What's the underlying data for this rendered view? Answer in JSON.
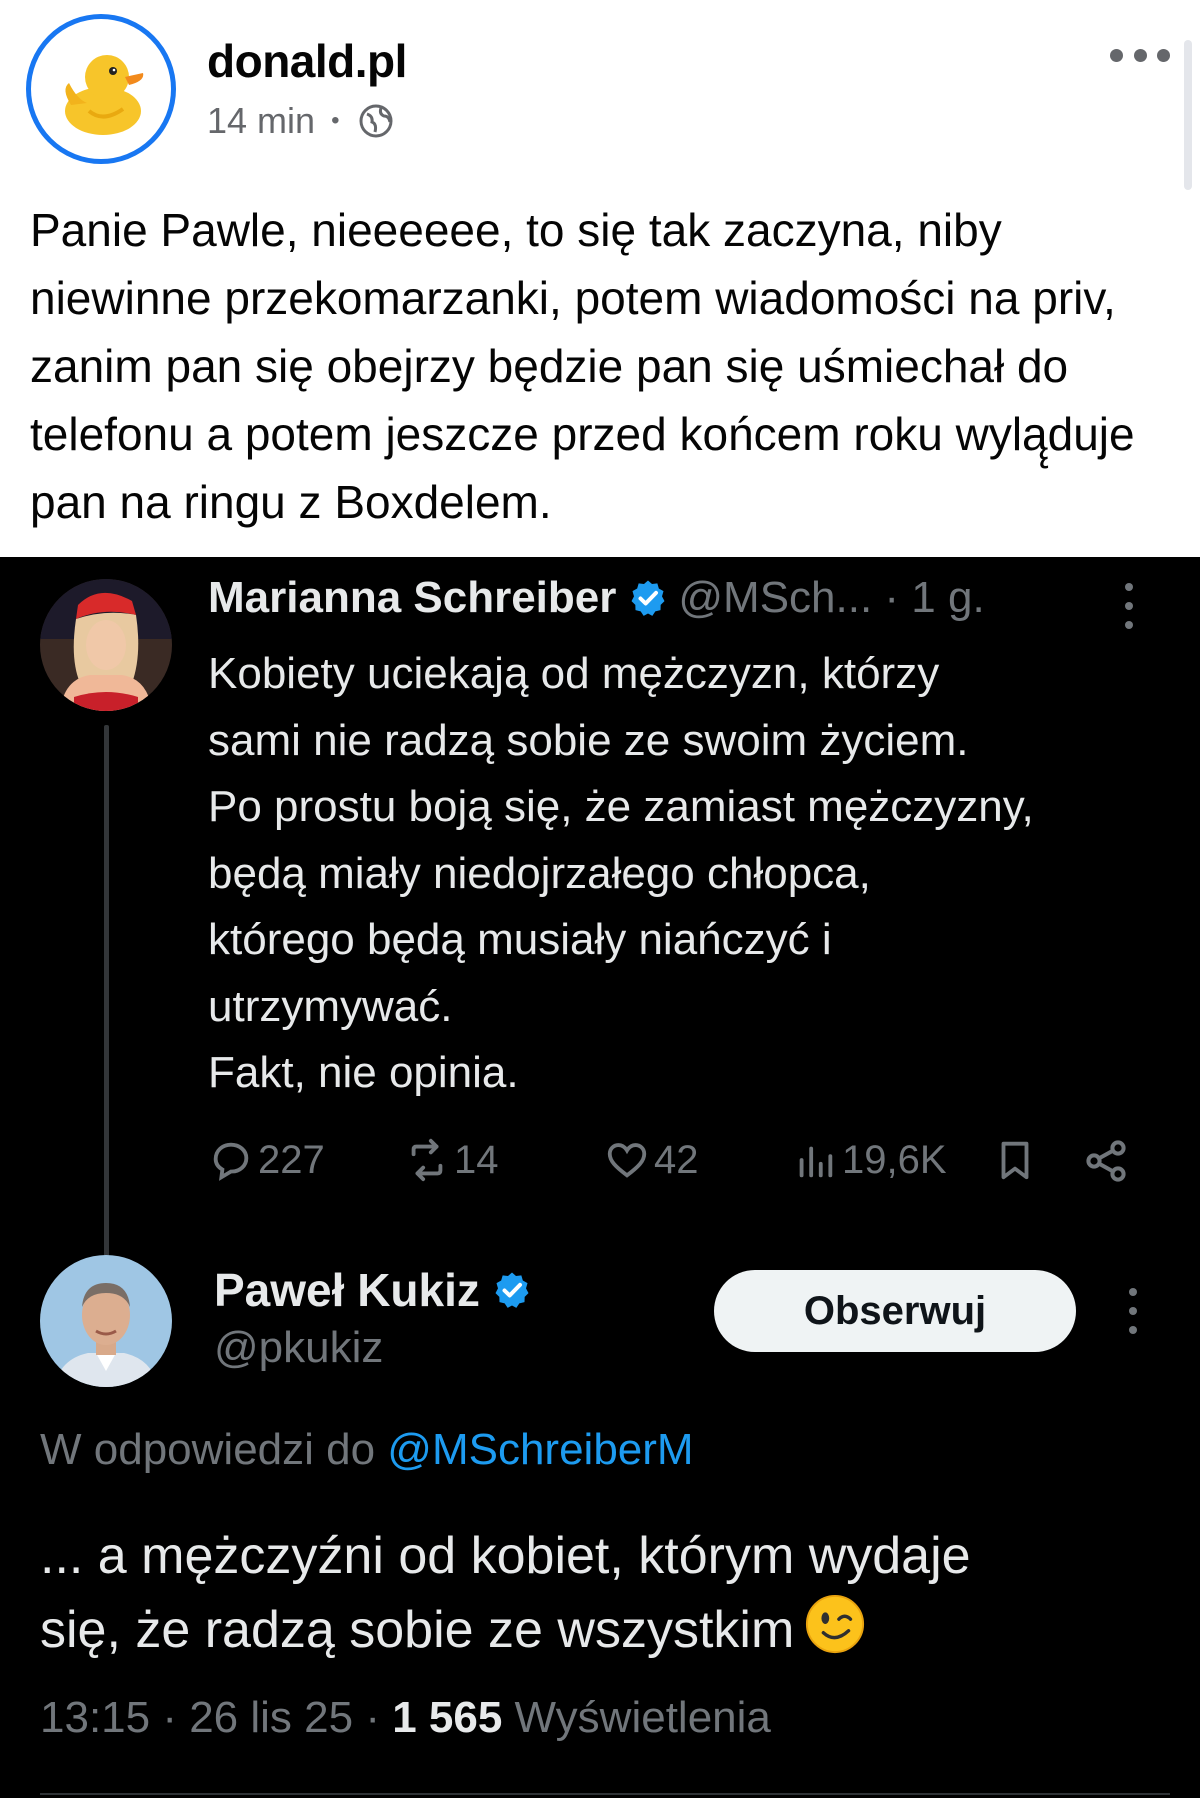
{
  "post": {
    "page_name": "donald.pl",
    "time": "14 min",
    "separator": "•",
    "audience_icon": "globe-icon",
    "more_icon": "more-dots-icon",
    "text": "Panie Pawle, nieeeeee, to się tak zaczyna, niby niewinne przekomarzanki, potem wiadomości na priv, zanim pan się obejrzy będzie pan się uśmiechał do telefonu a potem jeszcze przed końcem roku wylą̨duje pan na ringu z Boxdelem."
  },
  "tweet1": {
    "name": "Marianna Schreiber",
    "verified_icon": "verified-badge-icon",
    "handle_time": "@MSch... · 1 g.",
    "lines": [
      "Kobiety uciekają od mężczyzn, którzy",
      "sami nie radzą sobie ze swoim życiem.",
      "Po prostu boją się, że zamiast mężczyzny,",
      "będą miały niedojrzałego chłopca,",
      "którego będą musiały niańczyć i",
      "utrzymywać.",
      "Fakt, nie opinia."
    ],
    "actions": {
      "replies": "227",
      "reposts": "14",
      "likes": "42",
      "views": "19,6K"
    }
  },
  "tweet2": {
    "name": "Paweł Kukiz",
    "verified_icon": "verified-badge-icon",
    "handle": "@pkukiz",
    "follow_label": "Obserwuj",
    "reply_prefix": "W odpowiedzi do ",
    "reply_mention": "@MSchreiberM",
    "lines": [
      "... a mężczyźni od kobiet, którym wydaje",
      "się, że radzą sobie ze wszystkim"
    ],
    "emoji": "winking-face-icon",
    "meta_prefix": "13:15 · 26 lis 25 · ",
    "views_count": "1 565",
    "views_label": " Wyświetlenia"
  },
  "colors": {
    "facebook_blue": "#1877f2",
    "x_blue": "#1d9bf0",
    "x_background": "#000000",
    "x_secondary_text": "#71767b"
  }
}
